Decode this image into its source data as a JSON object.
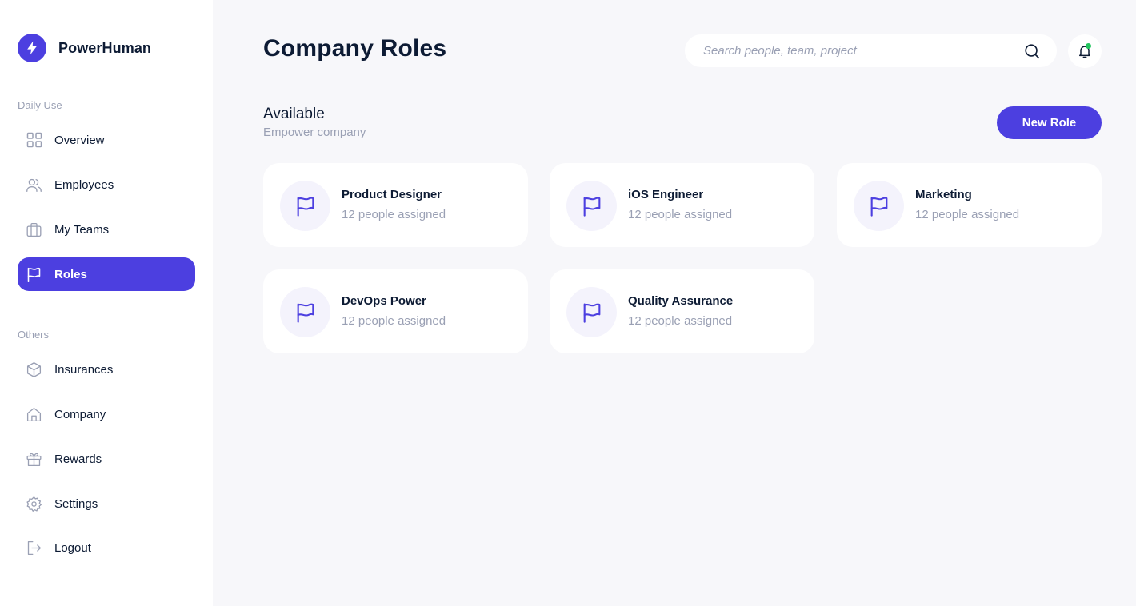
{
  "brand": {
    "name": "PowerHuman",
    "logo_icon": "lightning-bolt-icon",
    "color": "#4C3FE0"
  },
  "sidebar": {
    "daily_label": "Daily Use",
    "others_label": "Others",
    "items": [
      {
        "label": "Overview",
        "icon": "grid-icon"
      },
      {
        "label": "Employees",
        "icon": "users-icon"
      },
      {
        "label": "My Teams",
        "icon": "briefcase-icon"
      },
      {
        "label": "Roles",
        "icon": "flag-icon",
        "active": true
      },
      {
        "label": "Insurances",
        "icon": "box-icon"
      },
      {
        "label": "Company",
        "icon": "home-icon"
      },
      {
        "label": "Rewards",
        "icon": "gift-icon"
      },
      {
        "label": "Settings",
        "icon": "gear-icon"
      },
      {
        "label": "Logout",
        "icon": "logout-icon"
      }
    ]
  },
  "header": {
    "title": "Company Roles",
    "search_placeholder": "Search people, team, project",
    "search_icon": "search-icon",
    "bell_icon": "bell-icon"
  },
  "section": {
    "title": "Available",
    "subtitle": "Empower company",
    "new_role_label": "New Role"
  },
  "roles": [
    {
      "name": "Product Designer",
      "meta": "12 people assigned",
      "icon": "flag-icon"
    },
    {
      "name": "iOS Engineer",
      "meta": "12 people assigned",
      "icon": "flag-icon"
    },
    {
      "name": "Marketing",
      "meta": "12 people assigned",
      "icon": "flag-icon"
    },
    {
      "name": "DevOps Power",
      "meta": "12 people assigned",
      "icon": "flag-icon"
    },
    {
      "name": "Quality Assurance",
      "meta": "12 people assigned",
      "icon": "flag-icon"
    }
  ],
  "colors": {
    "accent": "#4C3FE0",
    "muted": "#9AA0B4",
    "text": "#0D1B34",
    "background": "#F7F7FA",
    "notification": "#22C55E"
  }
}
